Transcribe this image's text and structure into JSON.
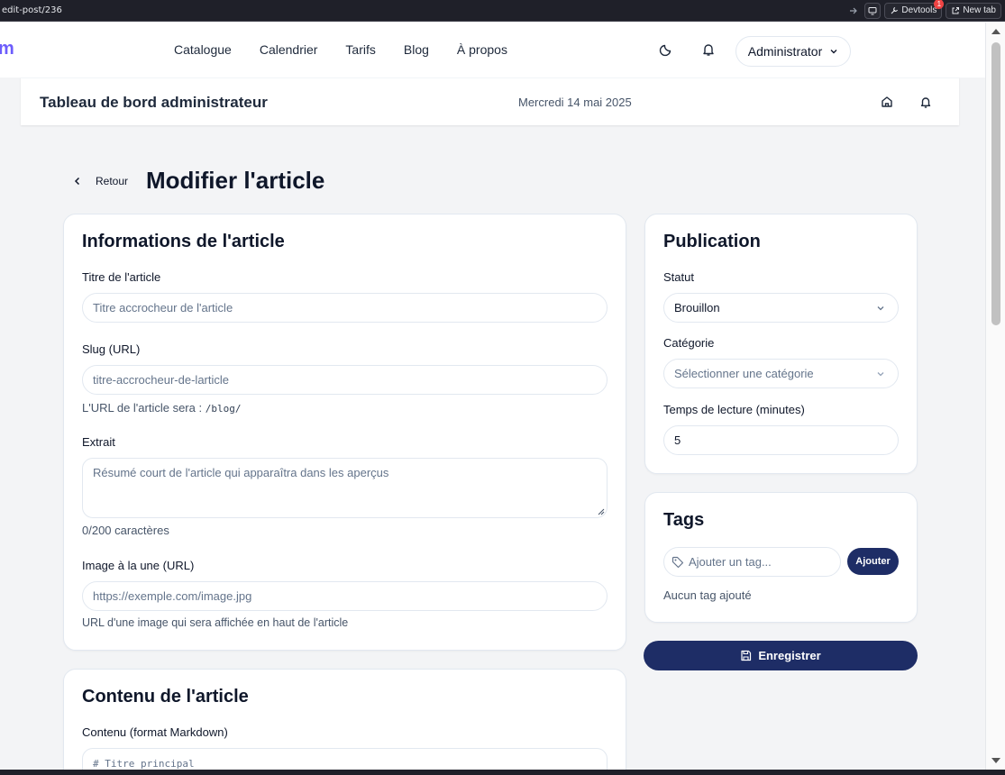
{
  "browser": {
    "url": "edit-post/236",
    "devtools_label": "Devtools",
    "devtools_badge": "1",
    "newtab_label": "New tab"
  },
  "site": {
    "brand": "m",
    "brand_color": "#6d5dfc",
    "nav": [
      "Catalogue",
      "Calendrier",
      "Tarifs",
      "Blog",
      "À propos"
    ],
    "theme_icon": "moon-icon",
    "bell_icon": "bell-icon",
    "user_menu": "Administrator"
  },
  "dashboard": {
    "title": "Tableau de bord administrateur",
    "date": "Mercredi 14 mai 2025",
    "home_icon": "home-icon",
    "bell_icon": "bell-icon"
  },
  "page": {
    "back_label": "Retour",
    "title": "Modifier l'article"
  },
  "info_card": {
    "heading": "Informations de l'article",
    "title_label": "Titre de l'article",
    "title_placeholder": "Titre accrocheur de l'article",
    "slug_label": "Slug (URL)",
    "slug_placeholder": "titre-accrocheur-de-larticle",
    "slug_help": "L'URL de l'article sera :",
    "slug_prefix": "/blog/",
    "excerpt_label": "Extrait",
    "excerpt_placeholder": "Résumé court de l'article qui apparaîtra dans les aperçus",
    "excerpt_count": "0/200 caractères",
    "image_label": "Image à la une (URL)",
    "image_placeholder": "https://exemple.com/image.jpg",
    "image_help": "URL d'une image qui sera affichée en haut de l'article"
  },
  "content_card": {
    "heading": "Contenu de l'article",
    "content_label": "Contenu (format Markdown)",
    "content_placeholder": "# Titre principal"
  },
  "publication_card": {
    "heading": "Publication",
    "status_label": "Statut",
    "status_value": "Brouillon",
    "category_label": "Catégorie",
    "category_placeholder": "Sélectionner une catégorie",
    "reading_label": "Temps de lecture (minutes)",
    "reading_value": "5"
  },
  "tags_card": {
    "heading": "Tags",
    "tag_placeholder": "Ajouter un tag...",
    "add_label": "Ajouter",
    "empty_text": "Aucun tag ajouté"
  },
  "save_label": "Enregistrer",
  "colors": {
    "primary": "#1e2d66",
    "border": "#e2e8f0",
    "page_bg": "#f3f4f6"
  }
}
